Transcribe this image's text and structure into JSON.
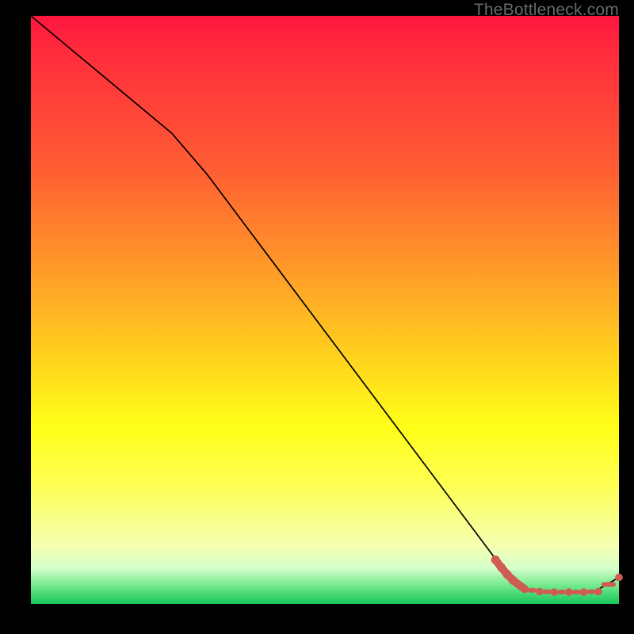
{
  "watermark": "TheBottleneck.com",
  "colors": {
    "marker": "#cf5b52",
    "curve": "#000000"
  },
  "chart_data": {
    "type": "line",
    "title": "",
    "xlabel": "",
    "ylabel": "",
    "xlim": [
      0,
      100
    ],
    "ylim": [
      0,
      100
    ],
    "grid": false,
    "series": [
      {
        "name": "bottleneck-curve",
        "x": [
          0.0,
          6.0,
          12.0,
          18.0,
          24.0,
          30.0,
          36.0,
          42.0,
          48.0,
          54.0,
          60.0,
          66.0,
          72.0,
          78.0,
          81.0,
          84.0,
          87.0,
          90.0,
          93.0,
          96.0,
          100.0
        ],
        "y": [
          100.0,
          95.0,
          90.0,
          85.0,
          80.0,
          73.0,
          65.0,
          57.0,
          49.0,
          41.0,
          33.0,
          25.0,
          17.0,
          9.0,
          5.0,
          2.5,
          2.0,
          2.0,
          2.0,
          2.2,
          4.5
        ]
      }
    ],
    "markers": {
      "name": "highlight-points",
      "x": [
        79.0,
        80.0,
        81.0,
        82.0,
        84.0,
        86.5,
        89.0,
        91.5,
        94.0,
        96.5,
        100.0
      ],
      "y": [
        7.5,
        6.2,
        5.0,
        4.0,
        2.5,
        2.1,
        2.0,
        2.0,
        2.0,
        2.1,
        4.5
      ]
    }
  }
}
